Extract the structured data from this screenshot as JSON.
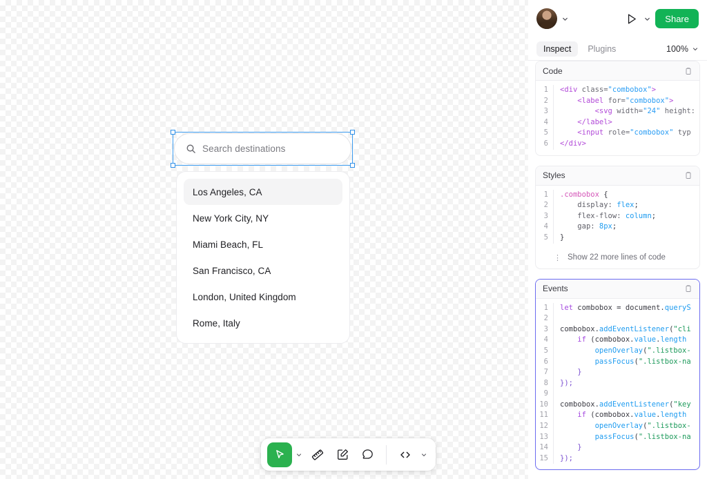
{
  "panel": {
    "avatar": "user-avatar",
    "play_label": "preview-play",
    "share_label": "Share",
    "tabs": [
      {
        "label": "Inspect",
        "active": true
      },
      {
        "label": "Plugins",
        "active": false
      }
    ],
    "zoom_level": "100%",
    "cards": [
      {
        "title": "Code",
        "focused": false,
        "line_numbers": [
          "1",
          "2",
          "3",
          "4",
          "5",
          "6"
        ],
        "lines": [
          [
            {
              "t": "tag",
              "v": "<div "
            },
            {
              "t": "attr",
              "v": "class="
            },
            {
              "t": "str",
              "v": "\"combobox\""
            },
            {
              "t": "tag",
              "v": ">"
            }
          ],
          [
            {
              "t": "plain",
              "v": "    "
            },
            {
              "t": "tag",
              "v": "<label "
            },
            {
              "t": "attr",
              "v": "for="
            },
            {
              "t": "str",
              "v": "\"combobox\""
            },
            {
              "t": "tag",
              "v": ">"
            }
          ],
          [
            {
              "t": "plain",
              "v": "        "
            },
            {
              "t": "tag",
              "v": "<svg "
            },
            {
              "t": "attr",
              "v": "width="
            },
            {
              "t": "str",
              "v": "\"24\""
            },
            {
              "t": "attr",
              "v": " height:"
            }
          ],
          [
            {
              "t": "plain",
              "v": "    "
            },
            {
              "t": "tag",
              "v": "</label>"
            }
          ],
          [
            {
              "t": "plain",
              "v": "    "
            },
            {
              "t": "tag",
              "v": "<input "
            },
            {
              "t": "attr",
              "v": "role="
            },
            {
              "t": "str",
              "v": "\"combobox\""
            },
            {
              "t": "attr",
              "v": " typ"
            }
          ],
          [
            {
              "t": "tag",
              "v": "</div>"
            }
          ]
        ],
        "show_more": null
      },
      {
        "title": "Styles",
        "focused": false,
        "line_numbers": [
          "1",
          "2",
          "3",
          "4",
          "5"
        ],
        "lines": [
          [
            {
              "t": "sel",
              "v": ".combobox"
            },
            {
              "t": "plain",
              "v": " {"
            }
          ],
          [
            {
              "t": "plain",
              "v": "    "
            },
            {
              "t": "prop",
              "v": "display:"
            },
            {
              "t": "val",
              "v": " flex"
            },
            {
              "t": "plain",
              "v": ";"
            }
          ],
          [
            {
              "t": "plain",
              "v": "    "
            },
            {
              "t": "prop",
              "v": "flex-flow:"
            },
            {
              "t": "val",
              "v": " column"
            },
            {
              "t": "plain",
              "v": ";"
            }
          ],
          [
            {
              "t": "plain",
              "v": "    "
            },
            {
              "t": "prop",
              "v": "gap:"
            },
            {
              "t": "val",
              "v": " 8px"
            },
            {
              "t": "plain",
              "v": ";"
            }
          ],
          [
            {
              "t": "plain",
              "v": "}"
            }
          ]
        ],
        "show_more": "Show 22 more lines of code"
      },
      {
        "title": "Events",
        "focused": true,
        "line_numbers": [
          "1",
          "2",
          "3",
          "4",
          "5",
          "6",
          "7",
          "8",
          "9",
          "10",
          "11",
          "12",
          "13",
          "14",
          "15"
        ],
        "lines": [
          [
            {
              "t": "kw",
              "v": "let"
            },
            {
              "t": "plain",
              "v": " combobox = document."
            },
            {
              "t": "fn",
              "v": "queryS"
            }
          ],
          [
            {
              "t": "plain",
              "v": ""
            }
          ],
          [
            {
              "t": "plain",
              "v": "combobox."
            },
            {
              "t": "fn",
              "v": "addEventListener"
            },
            {
              "t": "plain",
              "v": "("
            },
            {
              "t": "str2",
              "v": "\"cli"
            }
          ],
          [
            {
              "t": "plain",
              "v": "    "
            },
            {
              "t": "kw",
              "v": "if"
            },
            {
              "t": "plain",
              "v": " (combobox."
            },
            {
              "t": "val",
              "v": "value"
            },
            {
              "t": "plain",
              "v": "."
            },
            {
              "t": "val",
              "v": "length"
            },
            {
              "t": "plain",
              "v": " "
            }
          ],
          [
            {
              "t": "plain",
              "v": "        "
            },
            {
              "t": "fn",
              "v": "openOverlay"
            },
            {
              "t": "plain",
              "v": "("
            },
            {
              "t": "str2",
              "v": "\".listbox-"
            }
          ],
          [
            {
              "t": "plain",
              "v": "        "
            },
            {
              "t": "fn",
              "v": "passFocus"
            },
            {
              "t": "plain",
              "v": "("
            },
            {
              "t": "str2",
              "v": "\".listbox-na"
            }
          ],
          [
            {
              "t": "punc",
              "v": "    }"
            }
          ],
          [
            {
              "t": "punc",
              "v": "});"
            }
          ],
          [
            {
              "t": "plain",
              "v": ""
            }
          ],
          [
            {
              "t": "plain",
              "v": "combobox."
            },
            {
              "t": "fn",
              "v": "addEventListener"
            },
            {
              "t": "plain",
              "v": "("
            },
            {
              "t": "str2",
              "v": "\"key"
            }
          ],
          [
            {
              "t": "plain",
              "v": "    "
            },
            {
              "t": "kw",
              "v": "if"
            },
            {
              "t": "plain",
              "v": " (combobox."
            },
            {
              "t": "val",
              "v": "value"
            },
            {
              "t": "plain",
              "v": "."
            },
            {
              "t": "val",
              "v": "length"
            },
            {
              "t": "plain",
              "v": " "
            }
          ],
          [
            {
              "t": "plain",
              "v": "        "
            },
            {
              "t": "fn",
              "v": "openOverlay"
            },
            {
              "t": "plain",
              "v": "("
            },
            {
              "t": "str2",
              "v": "\".listbox-"
            }
          ],
          [
            {
              "t": "plain",
              "v": "        "
            },
            {
              "t": "fn",
              "v": "passFocus"
            },
            {
              "t": "plain",
              "v": "("
            },
            {
              "t": "str2",
              "v": "\".listbox-na"
            }
          ],
          [
            {
              "t": "punc",
              "v": "    }"
            }
          ],
          [
            {
              "t": "punc",
              "v": "});"
            }
          ]
        ],
        "show_more": null
      }
    ]
  },
  "canvas": {
    "search": {
      "placeholder": "Search destinations",
      "value": "",
      "selected": true
    },
    "listbox": {
      "items": [
        {
          "label": "Los Angeles, CA",
          "active": true
        },
        {
          "label": "New York City, NY",
          "active": false
        },
        {
          "label": "Miami Beach, FL",
          "active": false
        },
        {
          "label": "San Francisco, CA",
          "active": false
        },
        {
          "label": "London, United Kingdom",
          "active": false
        },
        {
          "label": "Rome, Italy",
          "active": false
        }
      ]
    }
  },
  "toolbar": {
    "tools": [
      {
        "name": "cursor-tool",
        "active": true
      },
      {
        "name": "measure-tool",
        "active": false
      },
      {
        "name": "annotate-tool",
        "active": false
      },
      {
        "name": "comment-tool",
        "active": false
      },
      {
        "name": "code-tool",
        "active": false
      }
    ]
  },
  "colors": {
    "accent_green": "#12b356",
    "tool_green": "#2bb14f",
    "selection_blue": "#3b9bf0",
    "focus_purple": "#6b6bf0"
  }
}
